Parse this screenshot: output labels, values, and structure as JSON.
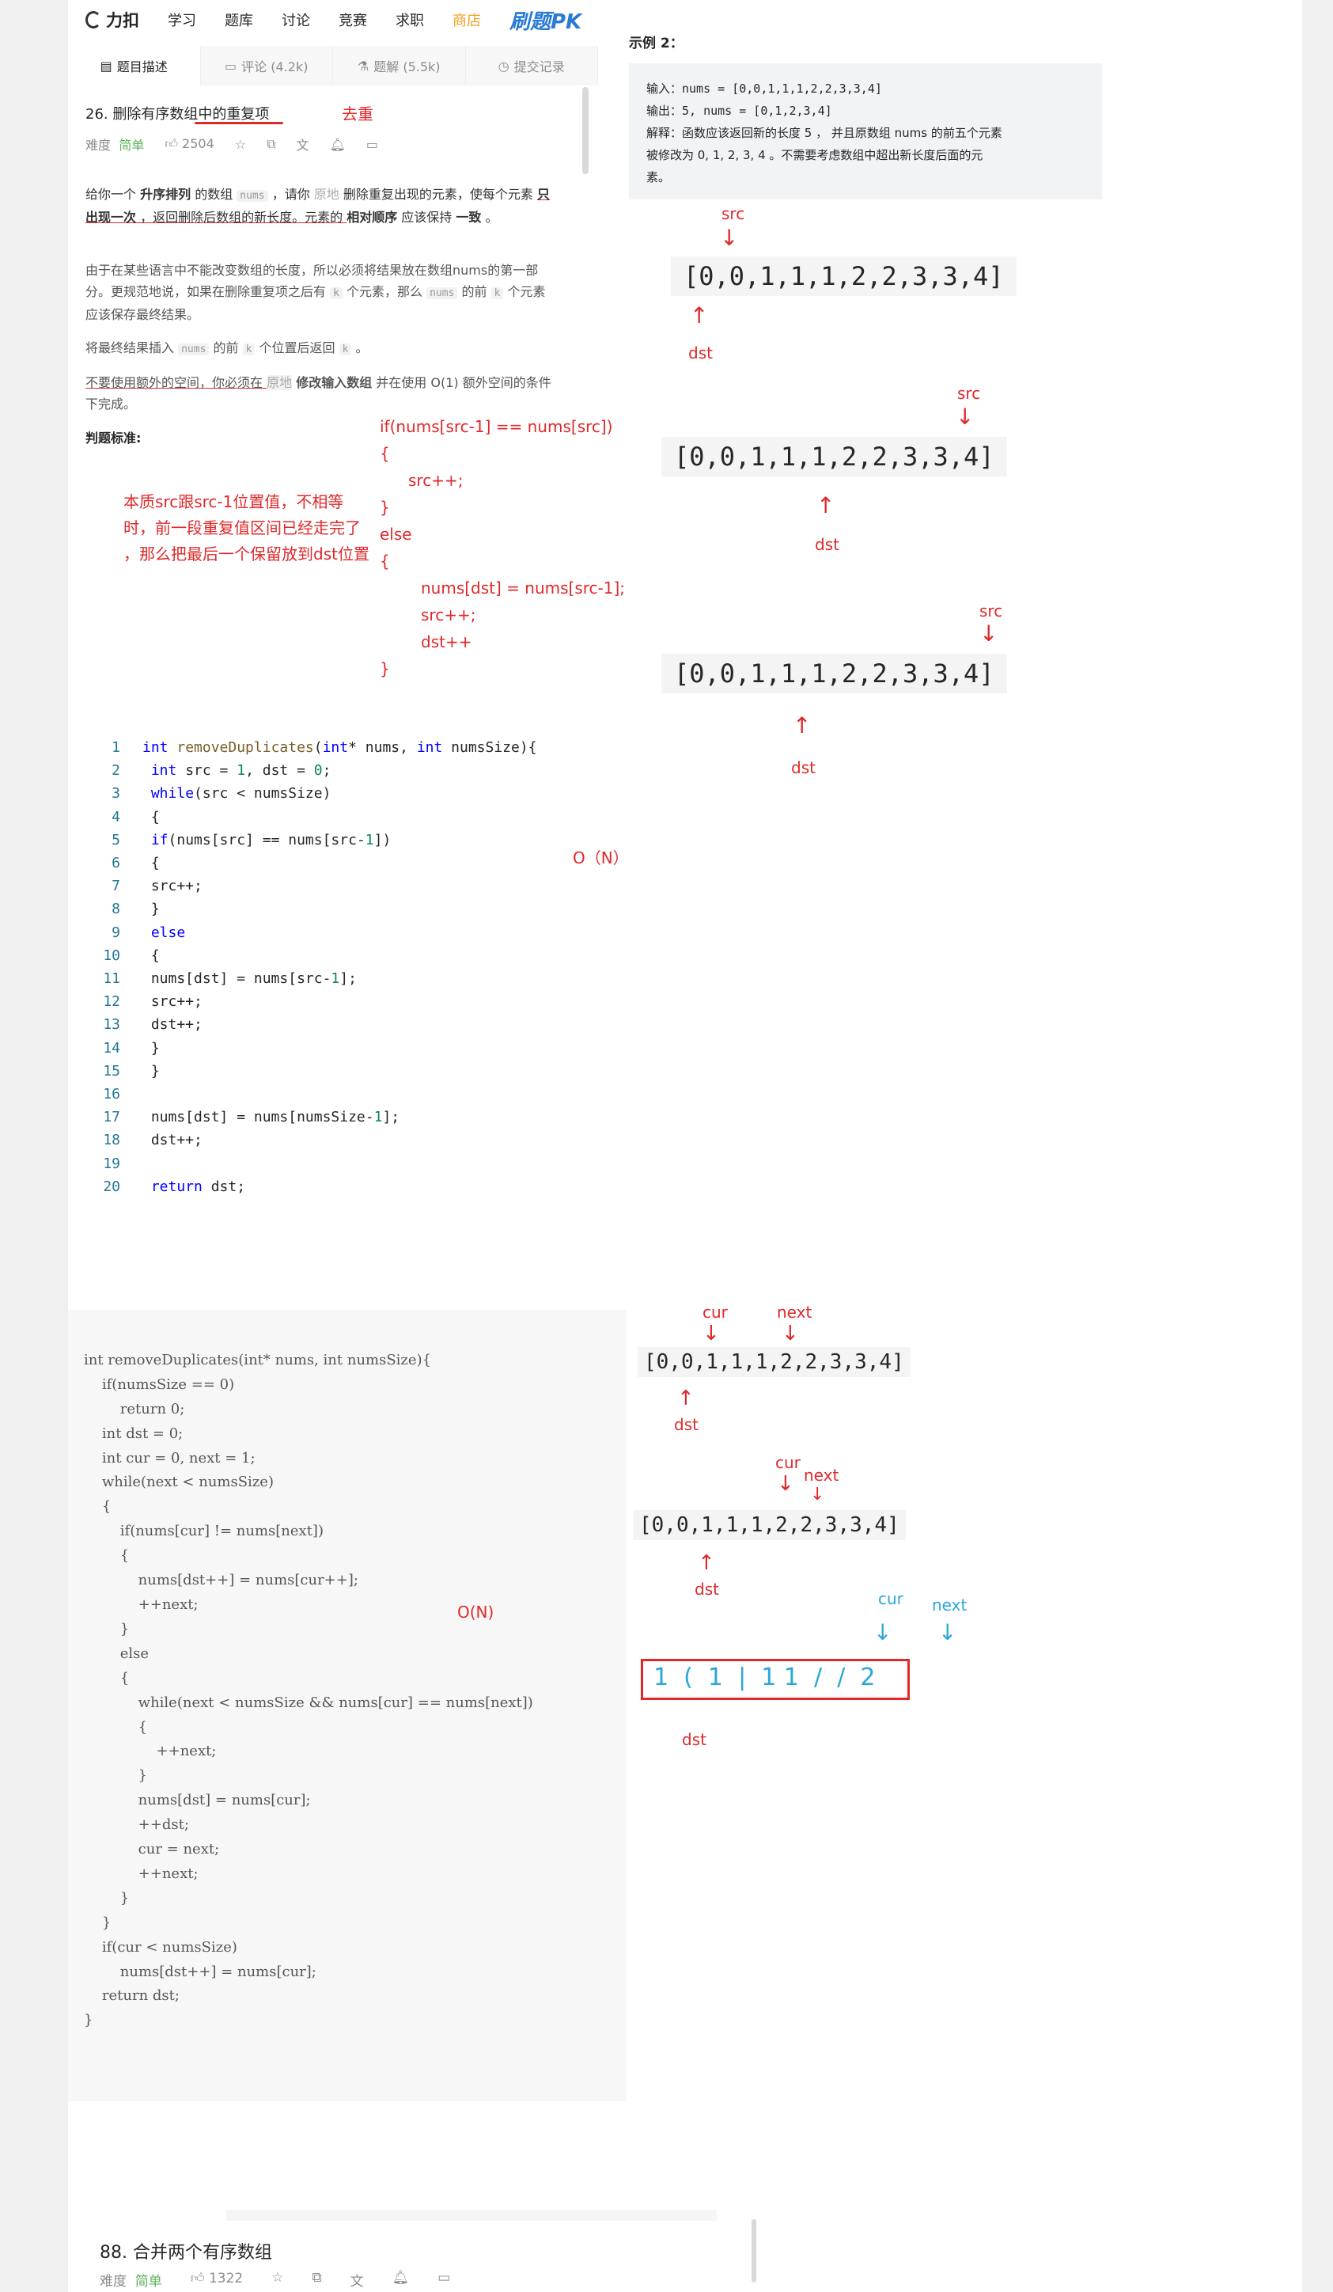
{
  "nav": {
    "logo": "力扣",
    "items": [
      "学习",
      "题库",
      "讨论",
      "竞赛",
      "求职"
    ],
    "shop": "商店",
    "pk": "刷题PK"
  },
  "tabs": [
    {
      "label": "题目描述"
    },
    {
      "label": "评论 (4.2k)"
    },
    {
      "label": "题解 (5.5k)"
    },
    {
      "label": "提交记录"
    }
  ],
  "problem": {
    "title": "26. 删除有序数组中的重复项",
    "difficulty_label": "难度",
    "difficulty": "简单",
    "likes": "2504",
    "desc1a": "给你一个 ",
    "desc1b": "升序排列",
    "desc1c": " 的数组 ",
    "desc1d": "nums",
    "desc1e": " ，请你 ",
    "desc1f": "原地",
    "desc1g": " 删除重复出现的元素，使每个元素 ",
    "desc1h": "只出现一次",
    "desc1i": " ，返回删除后数组的新长度。元素的 ",
    "desc1j": "相对顺序",
    "desc1k": " 应该保持 ",
    "desc1l": "一致",
    "desc1m": " 。",
    "desc2a": "由于在某些语言中不能改变数组的长度，所以必须将结果放在数组nums的第一部分。更规范地说，如果在删除重复项之后有 ",
    "desc2b": "k",
    "desc2c": " 个元素，那么 ",
    "desc2d": "nums",
    "desc2e": " 的前 ",
    "desc2f": "k",
    "desc2g": " 个元素应该保存最终结果。",
    "desc3a": "将最终结果插入 ",
    "desc3b": "nums",
    "desc3c": " 的前 ",
    "desc3d": "k",
    "desc3e": " 个位置后返回 ",
    "desc3f": "k",
    "desc3g": " 。",
    "desc4a": "不要使用额外的空间，你必须在 ",
    "desc4b": "原地",
    "desc4c": " ",
    "desc4d": "修改输入数组",
    "desc4e": " 并在使用 O(1) 额外空间的条件下完成。",
    "judge": "判题标准:"
  },
  "example": {
    "title": "示例 2：",
    "input": "输入：nums = [0,0,1,1,1,2,2,3,3,4]",
    "output": "输出：5, nums = [0,1,2,3,4]",
    "explain1": "解释：函数应该返回新的长度 5 ， 并且原数组 nums 的前五个元素",
    "explain2": "被修改为 0, 1, 2, 3, 4 。不需要考虑数组中超出新长度后面的元",
    "explain3": "素。"
  },
  "notes": {
    "dedupe": "去重",
    "pseudo": [
      "if(nums[src-1] == nums[src])",
      "{",
      "src++;",
      "}",
      "else",
      "{",
      "nums[dst] = nums[src-1];",
      "src++;",
      "dst++",
      "}"
    ],
    "essence": [
      "本质src跟src-1位置值，不相等",
      "时，前一段重复值区间已经走完了",
      "，那么把最后一个保留放到dst位置"
    ],
    "complexity1": "O（N）",
    "complexity2": "O(N)",
    "src": "src",
    "dst": "dst",
    "cur": "cur",
    "next": "next"
  },
  "arrays": {
    "a1": "[0,0,1,1,1,2,2,3,3,4]",
    "a2": "[0,0,1,1,1,2,2,3,3,4]",
    "a3": "[0,0,1,1,1,2,2,3,3,4]",
    "a4": "[0,0,1,1,1,2,2,3,3,4]",
    "a5": "[0,0,1,1,1,2,2,3,3,4]",
    "a6": "1  (  1  |  1 1  /  /  2"
  },
  "code1": [
    "int removeDuplicates(int* nums, int numsSize){",
    "    int src = 1, dst = 0;",
    "    while(src < numsSize)",
    "    {",
    "        if(nums[src] == nums[src-1])",
    "        {",
    "            src++;",
    "        }",
    "        else",
    "        {",
    "            nums[dst] = nums[src-1];",
    "            src++;",
    "            dst++;",
    "        }",
    "    }",
    "",
    "    nums[dst] = nums[numsSize-1];",
    "    dst++;",
    "",
    "    return dst;"
  ],
  "code2": [
    "int removeDuplicates(int* nums, int numsSize){",
    "    if(numsSize == 0)",
    "        return 0;",
    "",
    "    int dst = 0;",
    "    int cur = 0, next = 1;",
    "    while(next < numsSize)",
    "    {",
    "        if(nums[cur] != nums[next])",
    "        {",
    "            nums[dst++] = nums[cur++];",
    "            ++next;",
    "        }",
    "        else",
    "        {",
    "            while(next < numsSize && nums[cur] == nums[next])",
    "            {",
    "                ++next;",
    "            }",
    "",
    "            nums[dst] = nums[cur];",
    "            ++dst;",
    "            cur = next;",
    "            ++next;",
    "        }",
    "    }",
    "",
    "    if(cur < numsSize)",
    "        nums[dst++] = nums[cur];",
    "",
    "    return dst;",
    "}"
  ],
  "problem88": {
    "title": "88. 合并两个有序数组",
    "difficulty_label": "难度",
    "difficulty": "简单",
    "likes": "1322"
  },
  "colors": {
    "red": "#e0282a",
    "blue": "#2aa7d9",
    "easy": "#5bb45b"
  }
}
